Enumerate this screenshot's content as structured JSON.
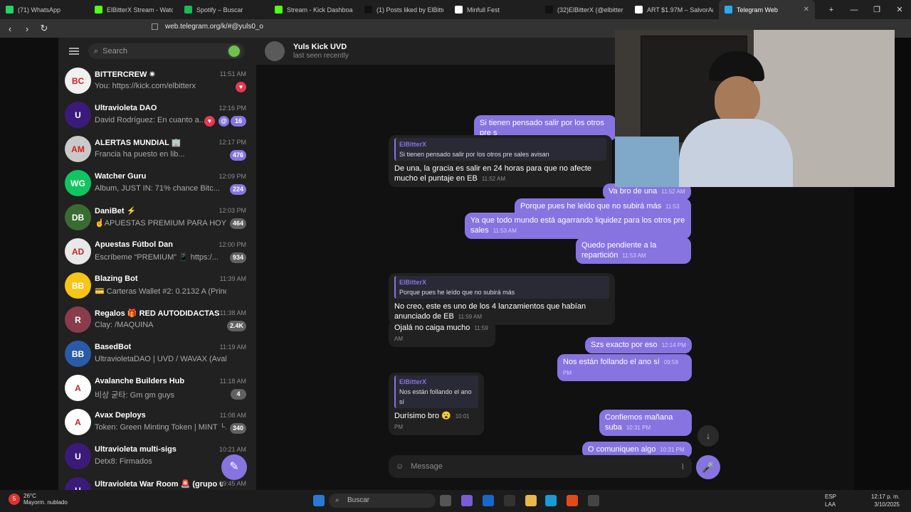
{
  "browser": {
    "tabs": [
      {
        "label": "(71) WhatsApp",
        "color": "#25d366"
      },
      {
        "label": "ElBitterX Stream - Watch L",
        "color": "#53fc18"
      },
      {
        "label": "Spotify – Buscar",
        "color": "#1db954"
      },
      {
        "label": "Stream - Kick Dashboard",
        "color": "#53fc18"
      },
      {
        "label": "(1) Posts liked by ElBitterX",
        "color": "#111111"
      },
      {
        "label": "Minfull Fest",
        "color": "#ffffff"
      },
      {
        "label": "(32)ElBitterX (@elbitterx.k",
        "color": "#111111"
      },
      {
        "label": "ART $1.97M – SalvorArt.io",
        "color": "#ffffff"
      },
      {
        "label": "Telegram Web",
        "color": "#2aabee"
      }
    ],
    "url": "web.telegram.org/k/#@yuls0_o"
  },
  "sidebar": {
    "search_placeholder": "Search",
    "chats": [
      {
        "name": "BITTERCREW ✴",
        "time": "11:51 AM",
        "preview": "You: https://kick.com/elbitterx",
        "badge": "",
        "badge_type": "heart",
        "avatar_color": "#f0f0f0",
        "avatar_text": "BC"
      },
      {
        "name": "Ultravioleta DAO",
        "time": "12:16 PM",
        "preview": "David Rodríguez: En cuanto a...",
        "badge": "16",
        "badge_type": "multi",
        "avatar_color": "#3b1b7a",
        "avatar_text": "U"
      },
      {
        "name": "ALERTAS MUNDIAL 🏢",
        "time": "12:17 PM",
        "preview": "Francia ha puesto en lib...",
        "badge": "476",
        "badge_type": "normal",
        "avatar_color": "#c9c9c9",
        "avatar_text": "AM"
      },
      {
        "name": "Watcher Guru",
        "time": "12:09 PM",
        "preview": "Album, JUST IN: 71% chance Bitc...",
        "badge": "224",
        "badge_type": "normal",
        "avatar_color": "#11c462",
        "avatar_text": "WG"
      },
      {
        "name": "DaniBet ⚡",
        "time": "12:03 PM",
        "preview": "☝APUESTAS PREMIUM PARA HOY ...",
        "badge": "464",
        "badge_type": "muted",
        "avatar_color": "#3a6b32",
        "avatar_text": "DB"
      },
      {
        "name": "Apuestas Fútbol Dan",
        "time": "12:00 PM",
        "preview": "Escríbeme “PREMIUM” 📱 https:/...",
        "badge": "934",
        "badge_type": "muted",
        "avatar_color": "#e8e8e8",
        "avatar_text": "AD"
      },
      {
        "name": "Blazing Bot",
        "time": "11:39 AM",
        "preview": "💳 Carteras Wallet #2: 0.2132 A (Principal) ...",
        "badge": "",
        "badge_type": "none",
        "avatar_color": "#f5c518",
        "avatar_text": "BB"
      },
      {
        "name": "Regalos 🎁 RED AUTODIDACTAS",
        "time": "11:38 AM",
        "preview": "Clay: /MAQUINA",
        "badge": "2.4K",
        "badge_type": "muted",
        "avatar_color": "#8a3c4c",
        "avatar_text": "R"
      },
      {
        "name": "BasedBot",
        "time": "11:19 AM",
        "preview": "UltravioletaDAO | UVD / WAVAX (Avalanche...",
        "badge": "",
        "badge_type": "none",
        "avatar_color": "#2a5ba8",
        "avatar_text": "BB"
      },
      {
        "name": "Avalanche Builders Hub",
        "time": "11:18 AM",
        "preview": "비상 굳타: Gm gm guys",
        "badge": "4",
        "badge_type": "muted",
        "avatar_color": "#ffffff",
        "avatar_text": "A"
      },
      {
        "name": "Avax Deploys",
        "time": "11:08 AM",
        "preview": "Token: Green Minting Token | MINT └...",
        "badge": "340",
        "badge_type": "muted",
        "avatar_color": "#ffffff",
        "avatar_text": "A"
      },
      {
        "name": "Ultravioleta multi-sigs",
        "time": "10:21 AM",
        "preview": "Detx8: Firmados",
        "badge": "",
        "badge_type": "none",
        "avatar_color": "#3b1b7a",
        "avatar_text": "U"
      },
      {
        "name": "Ultravioleta War Room 🚨 (grupo u...",
        "time": "09:45 AM",
        "preview": "",
        "badge": "",
        "badge_type": "none",
        "avatar_color": "#3b1b7a",
        "avatar_text": "U"
      }
    ]
  },
  "chat": {
    "title": "Yuls Kick UVD",
    "status": "last seen recently",
    "composer_placeholder": "Message",
    "messages": [
      {
        "id": "m1",
        "dir": "out",
        "text": "Si tienen pensado salir por los otros pre s",
        "time": ""
      },
      {
        "id": "m2",
        "dir": "in",
        "reply_name": "ElBitterX",
        "reply_text": "Si tienen pensado salir por los otros pre sales avisan",
        "text": "De una, la gracia es salir en 24 horas para que no afecte mucho el puntaje en EB",
        "time": "11:52 AM"
      },
      {
        "id": "m3",
        "dir": "out",
        "text": "Va bro de una",
        "time": "11:52 AM"
      },
      {
        "id": "m4",
        "dir": "out",
        "text": "Porque pues he leído que no subirá más",
        "time": "11:53 AM"
      },
      {
        "id": "m5",
        "dir": "out",
        "text": "Ya que todo mundo está agarrando liquidez para los otros pre sales",
        "time": "11:53 AM"
      },
      {
        "id": "m6",
        "dir": "out",
        "text": "Quedo pendiente a la repartición",
        "time": "11:53 AM"
      },
      {
        "id": "m7",
        "dir": "in",
        "reply_name": "ElBitterX",
        "reply_text": "Porque pues he leído que no subirá más",
        "text": "No creo, este es uno de los 4 lanzamientos que habían anunciado de EB",
        "time": "11:59 AM"
      },
      {
        "id": "m8",
        "dir": "in",
        "text": "Ojalá no caiga mucho",
        "time": "11:59 AM"
      },
      {
        "id": "m9",
        "dir": "out",
        "text": "Szs exacto por eso",
        "time": "12:14 PM"
      },
      {
        "id": "m10",
        "dir": "out",
        "text": "Nos están follando el ano sí",
        "time": "09:59 PM"
      },
      {
        "id": "m11",
        "dir": "in",
        "reply_name": "ElBitterX",
        "reply_text": "Nos están follando el ano sí",
        "text": "Durísimo bro 😮",
        "time": "10:01 PM"
      },
      {
        "id": "m12",
        "dir": "out",
        "text": "Confiemos mañana suba",
        "time": "10:31 PM"
      },
      {
        "id": "m13",
        "dir": "out",
        "text": "O comuniquen algo",
        "time": "10:31 PM"
      }
    ]
  },
  "taskbar": {
    "weather_temp": "26°C",
    "weather_desc": "Mayorm. nublado",
    "search_label": "Buscar",
    "lang": "ESP",
    "lang2": "LAA",
    "time": "12:17 p. m.",
    "date": "3/10/2025",
    "notification_count": "5"
  }
}
